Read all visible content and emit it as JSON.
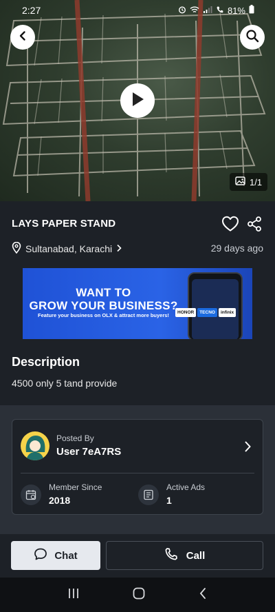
{
  "status_bar": {
    "time": "2:27",
    "battery": "81%"
  },
  "hero": {
    "image_counter": "1/1"
  },
  "listing": {
    "title": "LAYS PAPER STAND",
    "location": "Sultanabad, Karachi",
    "posted_ago": "29 days ago"
  },
  "banner": {
    "headline_line1": "WANT TO",
    "headline_line2": "GROW YOUR BUSINESS?",
    "subline": "Feature your business on OLX & attract more buyers!",
    "brands": [
      "HONOR",
      "TECNO",
      "infinix"
    ]
  },
  "description": {
    "heading": "Description",
    "text": "4500 only 5 tand provide"
  },
  "seller": {
    "posted_by_label": "Posted By",
    "user_name": "User 7eA7RS",
    "member_since_label": "Member Since",
    "member_since_value": "2018",
    "active_ads_label": "Active Ads",
    "active_ads_value": "1"
  },
  "actions": {
    "chat_label": "Chat",
    "call_label": "Call"
  },
  "colors": {
    "background": "#1d2127",
    "section_background": "#2b3038",
    "banner_blue": "#2a63e6",
    "chat_button": "#e6e9ee"
  }
}
